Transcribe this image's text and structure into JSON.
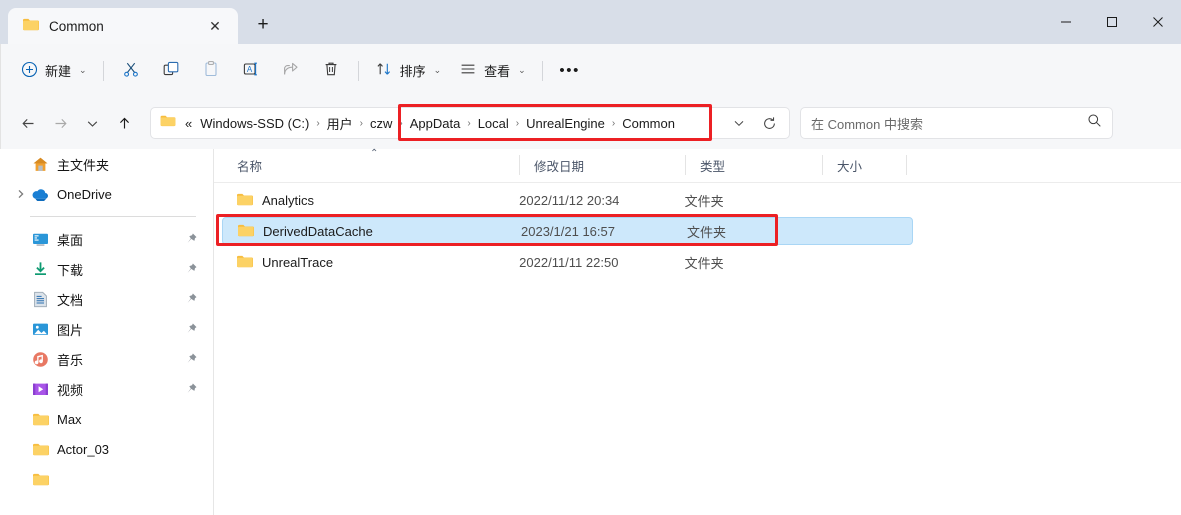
{
  "window": {
    "controls": [
      {
        "name": "minimize",
        "glyph": "—"
      },
      {
        "name": "maximize",
        "glyph": "□"
      },
      {
        "name": "close",
        "glyph": "✕"
      }
    ]
  },
  "tabs": {
    "active": {
      "label": "Common",
      "icon": "folder-icon",
      "close_glyph": "✕"
    },
    "new_tab_glyph": "+"
  },
  "toolbar": {
    "new_label": "新建",
    "sort_label": "排序",
    "view_label": "查看",
    "more_glyph": "•••",
    "chevron": "⌄",
    "items": [
      {
        "name": "new-button",
        "label": "新建",
        "icon": "plus-circle-icon",
        "disabled": false
      },
      {
        "name": "cut-button",
        "label": "",
        "icon": "scissors-icon",
        "disabled": false
      },
      {
        "name": "copy-button",
        "label": "",
        "icon": "copy-icon",
        "disabled": false
      },
      {
        "name": "paste-button",
        "label": "",
        "icon": "paste-icon",
        "disabled": true
      },
      {
        "name": "rename-button",
        "label": "",
        "icon": "rename-icon",
        "disabled": false
      },
      {
        "name": "share-button",
        "label": "",
        "icon": "share-icon",
        "disabled": true
      },
      {
        "name": "delete-button",
        "label": "",
        "icon": "trash-icon",
        "disabled": false
      },
      {
        "name": "sort-button",
        "label": "排序",
        "icon": "sort-icon",
        "disabled": false
      },
      {
        "name": "view-button",
        "label": "查看",
        "icon": "view-list-icon",
        "disabled": false
      },
      {
        "name": "more-button",
        "label": "",
        "icon": "ellipsis-icon",
        "disabled": false
      }
    ]
  },
  "address": {
    "back_glyph": "←",
    "forward_glyph": "→",
    "recent_glyph": "⌄",
    "up_glyph": "↑",
    "folder_icon": "folder-icon",
    "overflow": "«",
    "separator": "›",
    "crumbs": [
      "Windows-SSD (C:)",
      "用户",
      "czw",
      "AppData",
      "Local",
      "UnrealEngine",
      "Common"
    ],
    "dropdown_glyph": "⌄",
    "refresh_glyph": "↻"
  },
  "search": {
    "placeholder": "在 Common 中搜索",
    "icon": "search-icon"
  },
  "sidebar": {
    "items": [
      {
        "name": "sidebar-item-home",
        "label": "主文件夹",
        "icon": "home-icon",
        "expander": false,
        "pinned": false
      },
      {
        "name": "sidebar-item-onedrive",
        "label": "OneDrive",
        "icon": "cloud-icon",
        "expander": true,
        "pinned": false
      },
      {
        "name": "sidebar-divider",
        "label": "",
        "icon": "divider",
        "expander": false,
        "pinned": false
      },
      {
        "name": "sidebar-item-desktop",
        "label": "桌面",
        "icon": "desktop-icon",
        "expander": false,
        "pinned": true
      },
      {
        "name": "sidebar-item-downloads",
        "label": "下载",
        "icon": "download-icon",
        "expander": false,
        "pinned": true
      },
      {
        "name": "sidebar-item-documents",
        "label": "文档",
        "icon": "document-icon",
        "expander": false,
        "pinned": true
      },
      {
        "name": "sidebar-item-pictures",
        "label": "图片",
        "icon": "picture-icon",
        "expander": false,
        "pinned": true
      },
      {
        "name": "sidebar-item-music",
        "label": "音乐",
        "icon": "music-icon",
        "expander": false,
        "pinned": true
      },
      {
        "name": "sidebar-item-videos",
        "label": "视频",
        "icon": "video-icon",
        "expander": false,
        "pinned": true
      },
      {
        "name": "sidebar-item-max",
        "label": "Max",
        "icon": "folder-icon",
        "expander": false,
        "pinned": false
      },
      {
        "name": "sidebar-item-actor03",
        "label": "Actor_03",
        "icon": "folder-icon",
        "expander": false,
        "pinned": false
      }
    ]
  },
  "filelist": {
    "sort_caret": "⌃",
    "columns": [
      {
        "name": "column-name",
        "label": "名称",
        "sorted": true
      },
      {
        "name": "column-date",
        "label": "修改日期",
        "sorted": false
      },
      {
        "name": "column-type",
        "label": "类型",
        "sorted": false
      },
      {
        "name": "column-size",
        "label": "大小",
        "sorted": false
      }
    ],
    "rows": [
      {
        "name": "Analytics",
        "date": "2022/11/12 20:34",
        "type": "文件夹",
        "size": "",
        "icon": "folder-icon",
        "selected": false
      },
      {
        "name": "DerivedDataCache",
        "date": "2023/1/21 16:57",
        "type": "文件夹",
        "size": "",
        "icon": "folder-icon",
        "selected": true
      },
      {
        "name": "UnrealTrace",
        "date": "2022/11/11 22:50",
        "type": "文件夹",
        "size": "",
        "icon": "folder-icon",
        "selected": false
      }
    ]
  },
  "annotations": {
    "color": "#ec2024",
    "boxes": [
      {
        "name": "redbox-breadcrumb",
        "target": "AppData > Local > UnrealEngine > Common"
      },
      {
        "name": "redbox-row",
        "target": "DerivedDataCache"
      }
    ]
  }
}
